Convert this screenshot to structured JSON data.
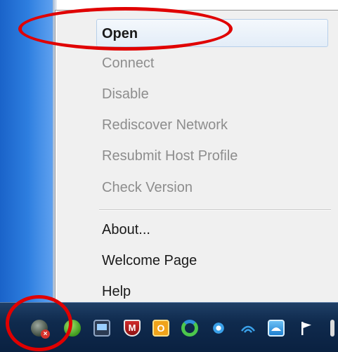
{
  "context_menu": {
    "items": [
      {
        "label": "Open",
        "enabled": true,
        "bold": true
      },
      {
        "label": "Connect",
        "enabled": false
      },
      {
        "label": "Disable",
        "enabled": false
      },
      {
        "label": "Rediscover Network",
        "enabled": false
      },
      {
        "label": "Resubmit Host Profile",
        "enabled": false
      },
      {
        "label": "Check Version",
        "enabled": false
      }
    ],
    "items_after_separator": [
      {
        "label": "About...",
        "enabled": true
      },
      {
        "label": "Welcome Page",
        "enabled": true
      },
      {
        "label": "Help",
        "enabled": true
      }
    ]
  },
  "taskbar": {
    "tray_icons": [
      "network-client-icon",
      "chat-icon",
      "network-monitor-icon",
      "mcafee-icon",
      "office-icon",
      "sync-icon",
      "network-diagnostics-icon",
      "wifi-icon",
      "cloud-icon",
      "action-center-flag-icon"
    ]
  },
  "annotations": {
    "color": "#e00000"
  }
}
